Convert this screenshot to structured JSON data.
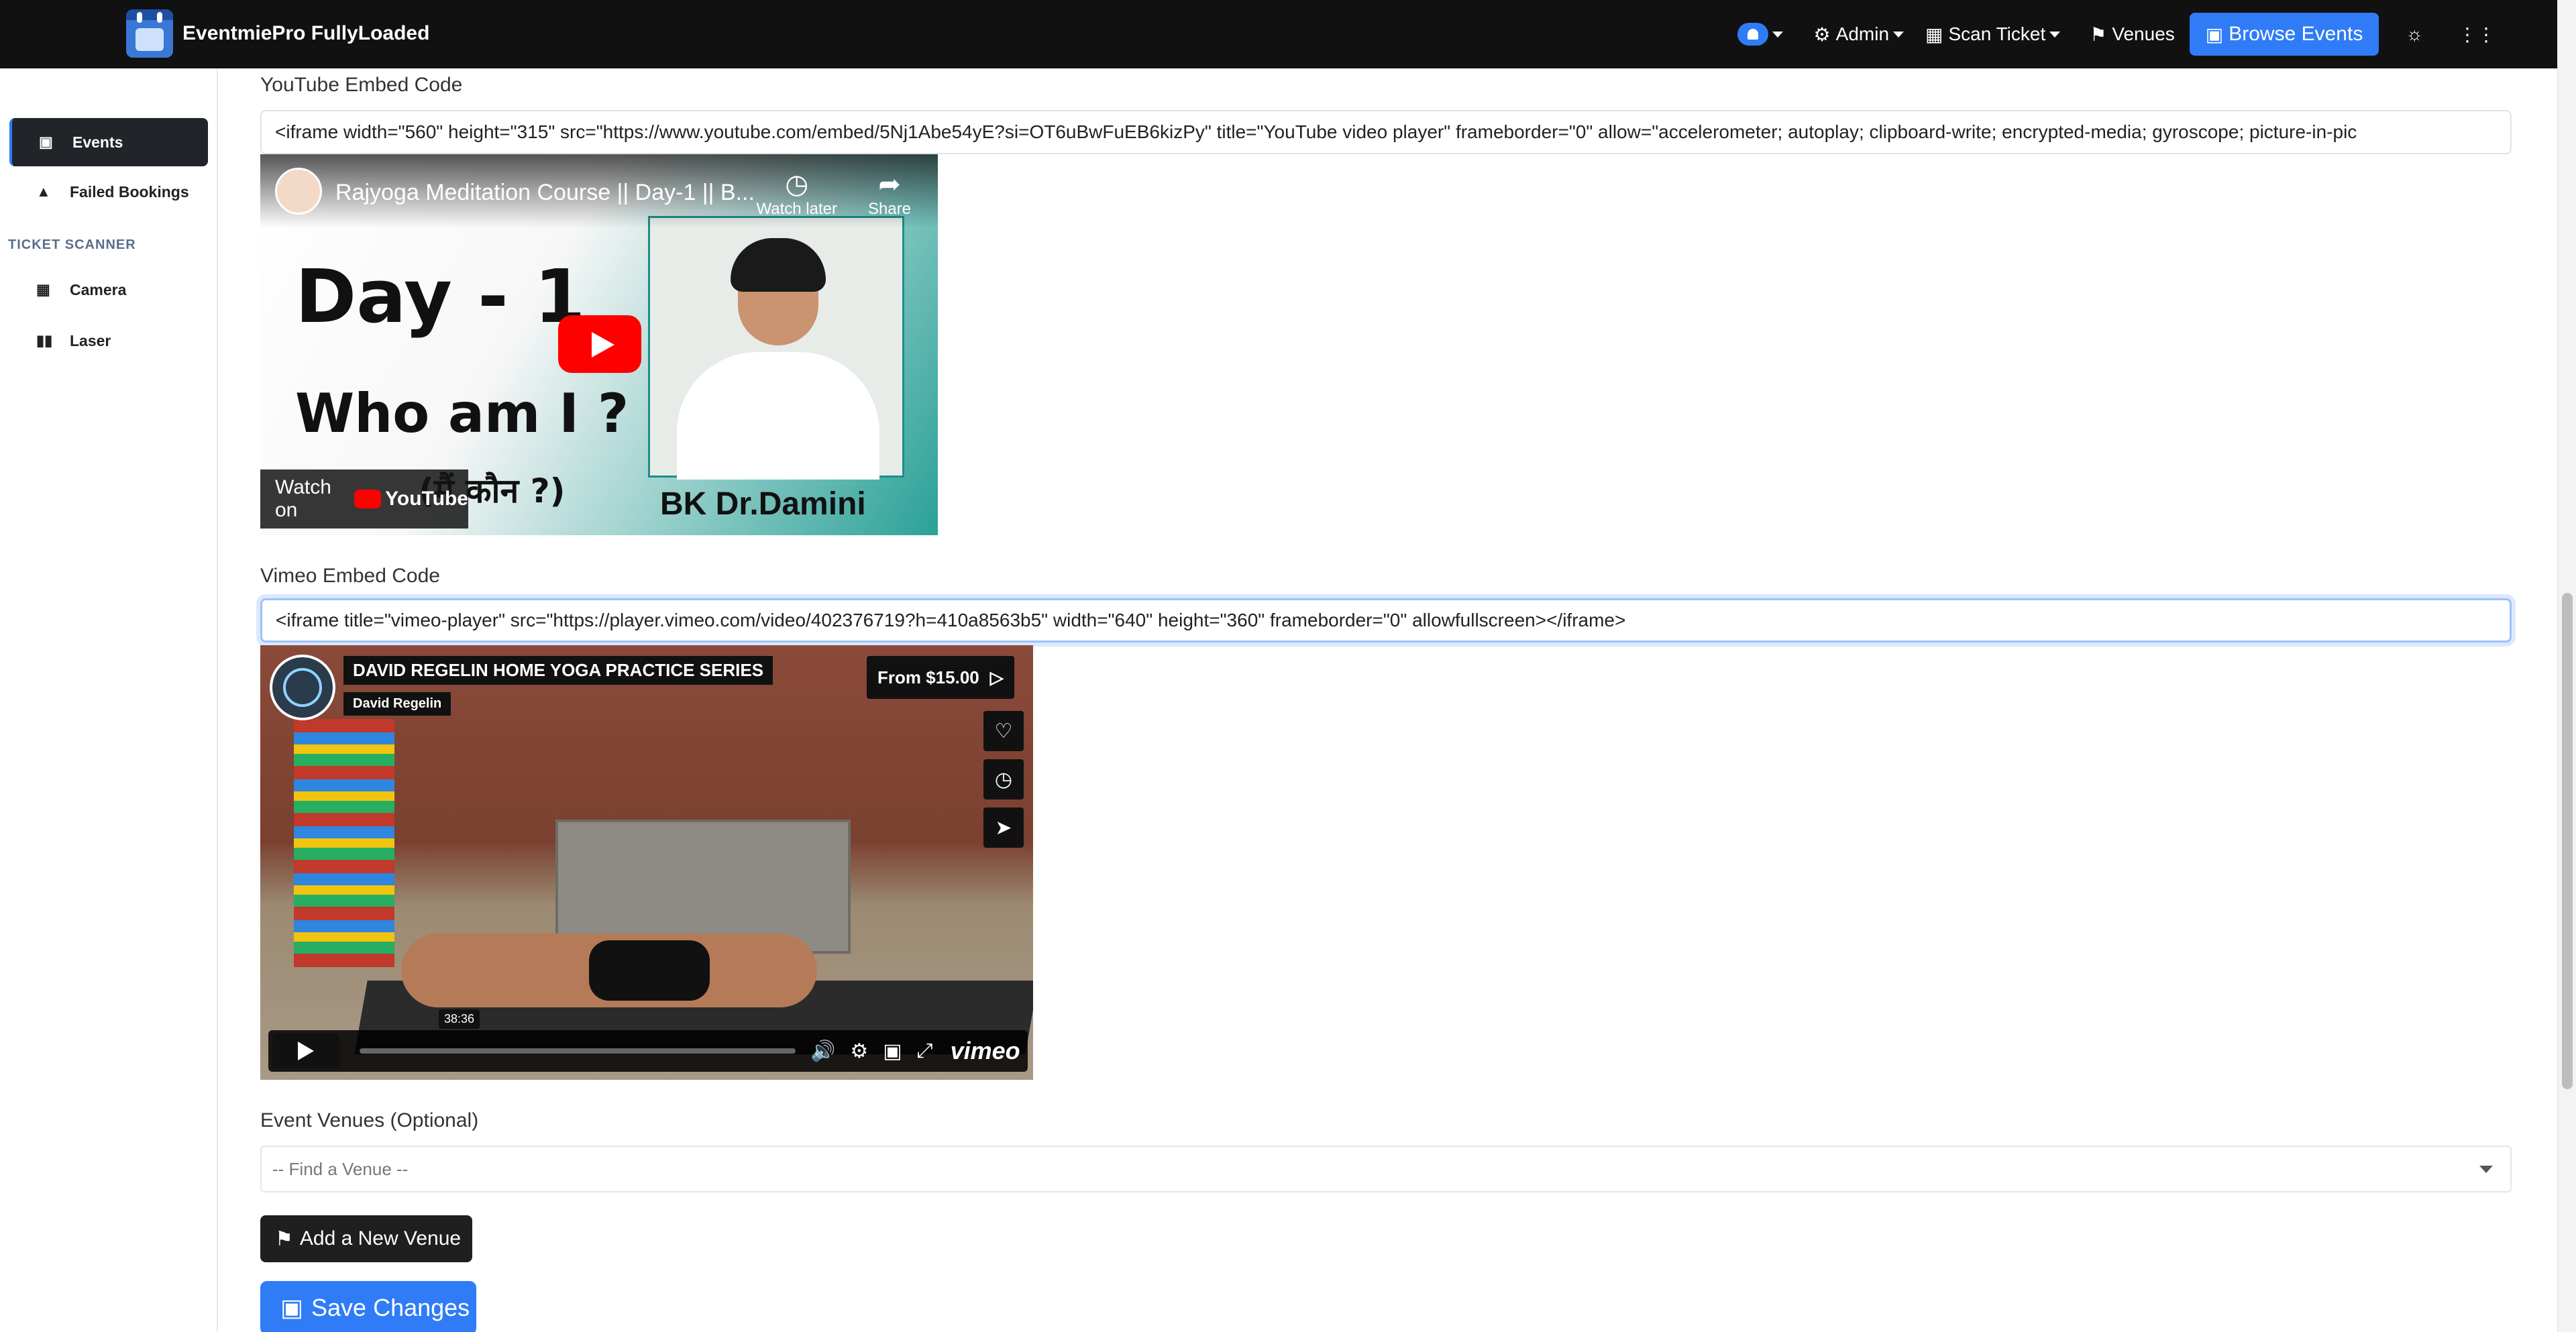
{
  "app": {
    "brand": "EventmiePro FullyLoaded"
  },
  "nav": {
    "admin": "Admin",
    "scan_ticket": "Scan Ticket",
    "venues": "Venues",
    "browse_events": "Browse Events"
  },
  "sidebar": {
    "items": [
      {
        "label": "Events",
        "icon": "calendar-icon",
        "active": true
      },
      {
        "label": "Failed Bookings",
        "icon": "warning-icon",
        "active": false
      }
    ],
    "section": "TICKET SCANNER",
    "scanner_items": [
      {
        "label": "Camera",
        "icon": "qrcode-icon"
      },
      {
        "label": "Laser",
        "icon": "barcode-icon"
      }
    ]
  },
  "youtube": {
    "label": "YouTube Embed Code",
    "value": "<iframe width=\"560\" height=\"315\" src=\"https://www.youtube.com/embed/5Nj1Abe54yE?si=OT6uBwFuEB6kizPy\" title=\"YouTube video player\" frameborder=\"0\" allow=\"accelerometer; autoplay; clipboard-write; encrypted-media; gyroscope; picture-in-pic",
    "video": {
      "title": "Rajyoga Meditation Course || Day-1 || B...",
      "watch_later": "Watch later",
      "share": "Share",
      "big_line1": "Day - 1",
      "big_line2": "Who am I ?",
      "big_line3": "(मैं कौन ?)",
      "caption": "BK Dr.Damini",
      "watch_on": "Watch on",
      "yt_brand": "YouTube"
    }
  },
  "vimeo": {
    "label": "Vimeo Embed Code",
    "value": "<iframe title=\"vimeo-player\" src=\"https://player.vimeo.com/video/402376719?h=410a8563b5\" width=\"640\" height=\"360\" frameborder=\"0\"    allowfullscreen></iframe>",
    "video": {
      "title": "DAVID REGELIN HOME YOGA PRACTICE SERIES",
      "author": "David Regelin",
      "price": "From $15.00",
      "time": "38:36",
      "brand": "vimeo"
    }
  },
  "venues": {
    "label": "Event Venues (Optional)",
    "placeholder": "-- Find a Venue --",
    "add_button": "Add a New Venue"
  },
  "actions": {
    "save": "Save Changes"
  },
  "colors": {
    "accent": "#2f7cf6",
    "navbar": "#111111",
    "sidebar_active": "#212529"
  }
}
